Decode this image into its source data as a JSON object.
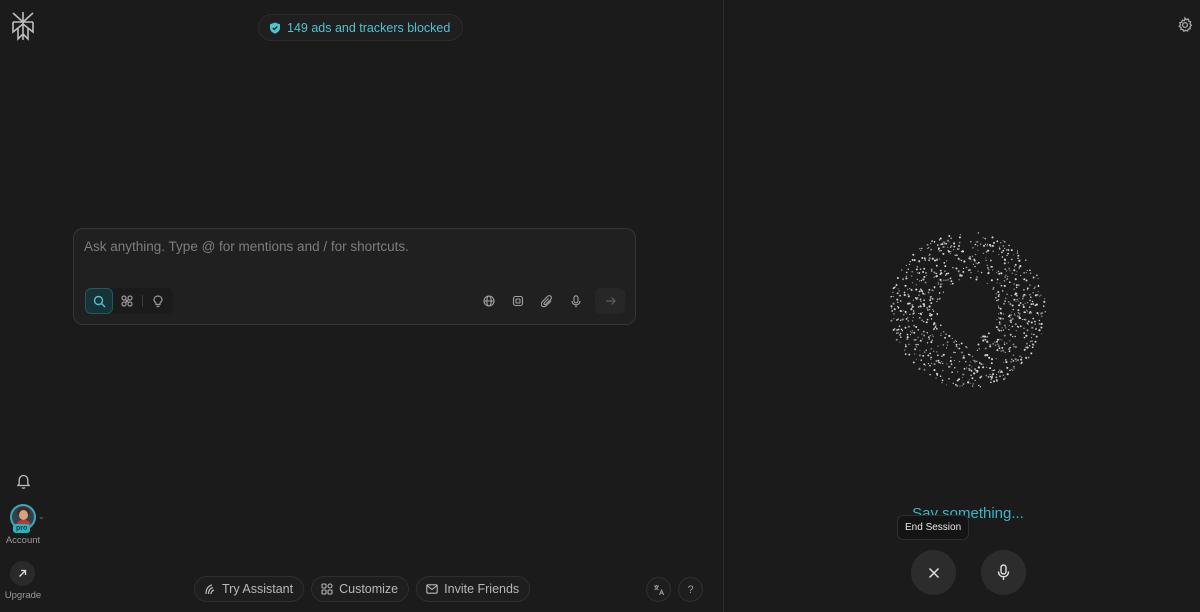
{
  "header": {
    "blocked_text": "149 ads and trackers blocked"
  },
  "sidebar": {
    "account_label": "Account",
    "pro_badge": "pro",
    "upgrade_label": "Upgrade"
  },
  "composer": {
    "placeholder": "Ask anything. Type @ for mentions and / for shortcuts."
  },
  "bottom_bar": {
    "try_assistant": "Try Assistant",
    "customize": "Customize",
    "invite_friends": "Invite Friends",
    "help": "?"
  },
  "voice_panel": {
    "status": "Say something...",
    "tooltip": "End Session"
  },
  "colors": {
    "accent": "#3bb6c4",
    "background": "#1b1b1b"
  },
  "icons": [
    "logo-icon",
    "shield-icon",
    "bell-icon",
    "arrow-up-right-icon",
    "search-icon",
    "apps-icon",
    "lightbulb-icon",
    "globe-icon",
    "chip-icon",
    "paperclip-icon",
    "mic-icon",
    "arrow-right-icon",
    "assistant-icon",
    "grid-icon",
    "mail-icon",
    "translate-icon",
    "gear-icon",
    "close-icon"
  ]
}
